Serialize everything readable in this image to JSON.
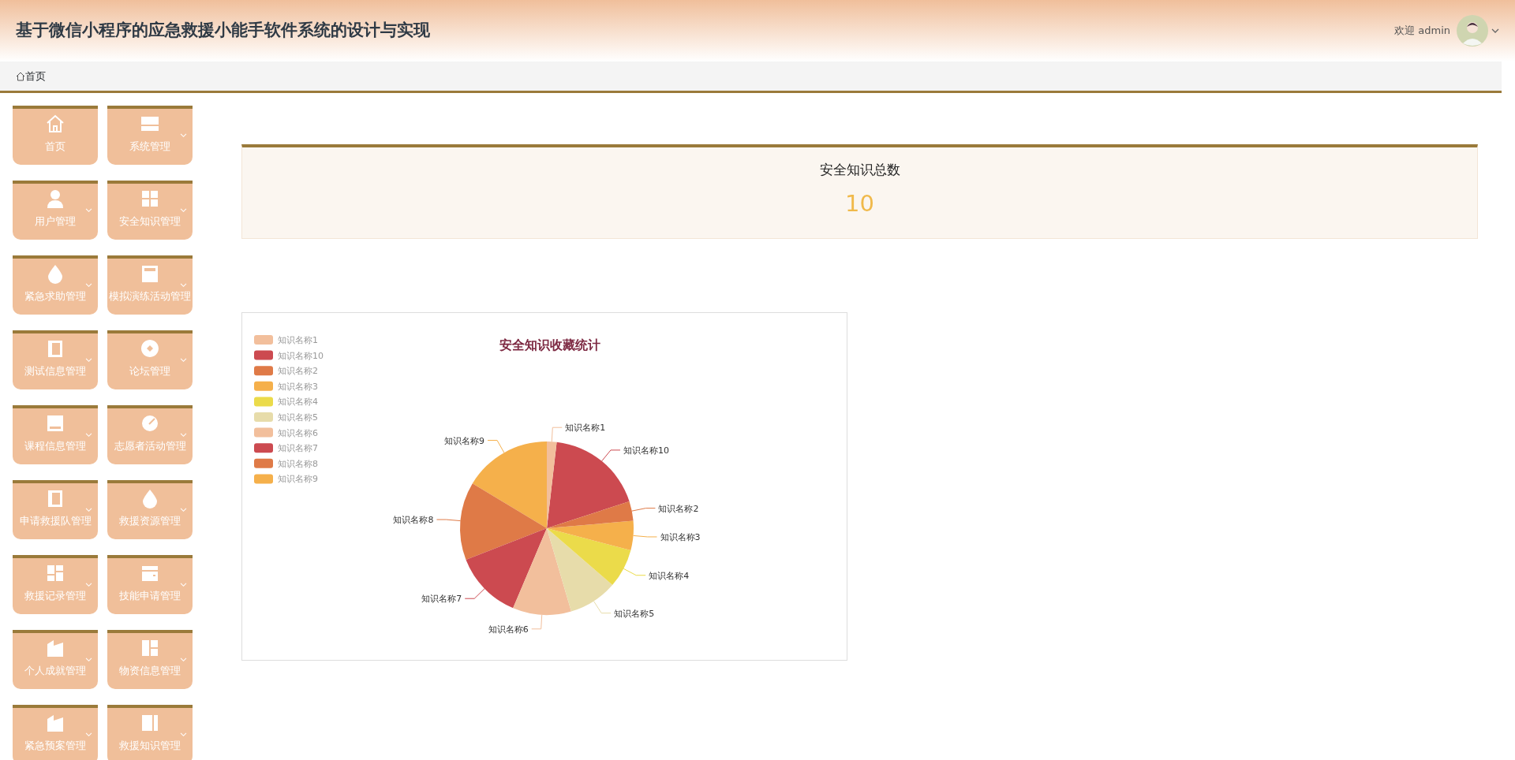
{
  "header": {
    "title": "基于微信小程序的应急救援小能手软件系统的设计与实现",
    "welcome": "欢迎 admin"
  },
  "breadcrumb": [
    {
      "label": "首页"
    }
  ],
  "sidebar": {
    "items": [
      {
        "label": "首页",
        "kind": "link"
      },
      {
        "label": "系统管理",
        "kind": "menu"
      },
      {
        "label": "用户管理",
        "kind": "menu"
      },
      {
        "label": "安全知识管理",
        "kind": "menu"
      },
      {
        "label": "紧急求助管理",
        "kind": "menu"
      },
      {
        "label": "模拟演练活动管理",
        "kind": "menu"
      },
      {
        "label": "测试信息管理",
        "kind": "menu"
      },
      {
        "label": "论坛管理",
        "kind": "menu"
      },
      {
        "label": "课程信息管理",
        "kind": "menu"
      },
      {
        "label": "志愿者活动管理",
        "kind": "menu"
      },
      {
        "label": "申请救援队管理",
        "kind": "menu"
      },
      {
        "label": "救援资源管理",
        "kind": "menu"
      },
      {
        "label": "救援记录管理",
        "kind": "menu"
      },
      {
        "label": "技能申请管理",
        "kind": "menu"
      },
      {
        "label": "个人成就管理",
        "kind": "menu"
      },
      {
        "label": "物资信息管理",
        "kind": "menu"
      },
      {
        "label": "紧急预案管理",
        "kind": "menu"
      },
      {
        "label": "救援知识管理",
        "kind": "menu"
      }
    ]
  },
  "stat": {
    "label": "安全知识总数",
    "value": "10"
  },
  "chart": {
    "legend": [
      {
        "label": "知识名称1",
        "color": "#f2bf9c"
      },
      {
        "label": "知识名称10",
        "color": "#cc4a50"
      },
      {
        "label": "知识名称2",
        "color": "#df7a47"
      },
      {
        "label": "知识名称3",
        "color": "#f5b04b"
      },
      {
        "label": "知识名称4",
        "color": "#ebdb4a"
      },
      {
        "label": "知识名称5",
        "color": "#e7dcaa"
      },
      {
        "label": "知识名称6",
        "color": "#f2bf9c"
      },
      {
        "label": "知识名称7",
        "color": "#cc4a50"
      },
      {
        "label": "知识名称8",
        "color": "#df7a47"
      },
      {
        "label": "知识名称9",
        "color": "#f5b04b"
      }
    ],
    "chart_data": {
      "type": "pie",
      "title": "安全知识收藏统计",
      "categories": [
        "知识名称1",
        "知识名称10",
        "知识名称2",
        "知识名称3",
        "知识名称4",
        "知识名称5",
        "知识名称6",
        "知识名称7",
        "知识名称8",
        "知识名称9"
      ],
      "values": [
        1,
        10,
        2,
        3,
        4,
        5,
        6,
        7,
        8,
        9
      ]
    }
  }
}
